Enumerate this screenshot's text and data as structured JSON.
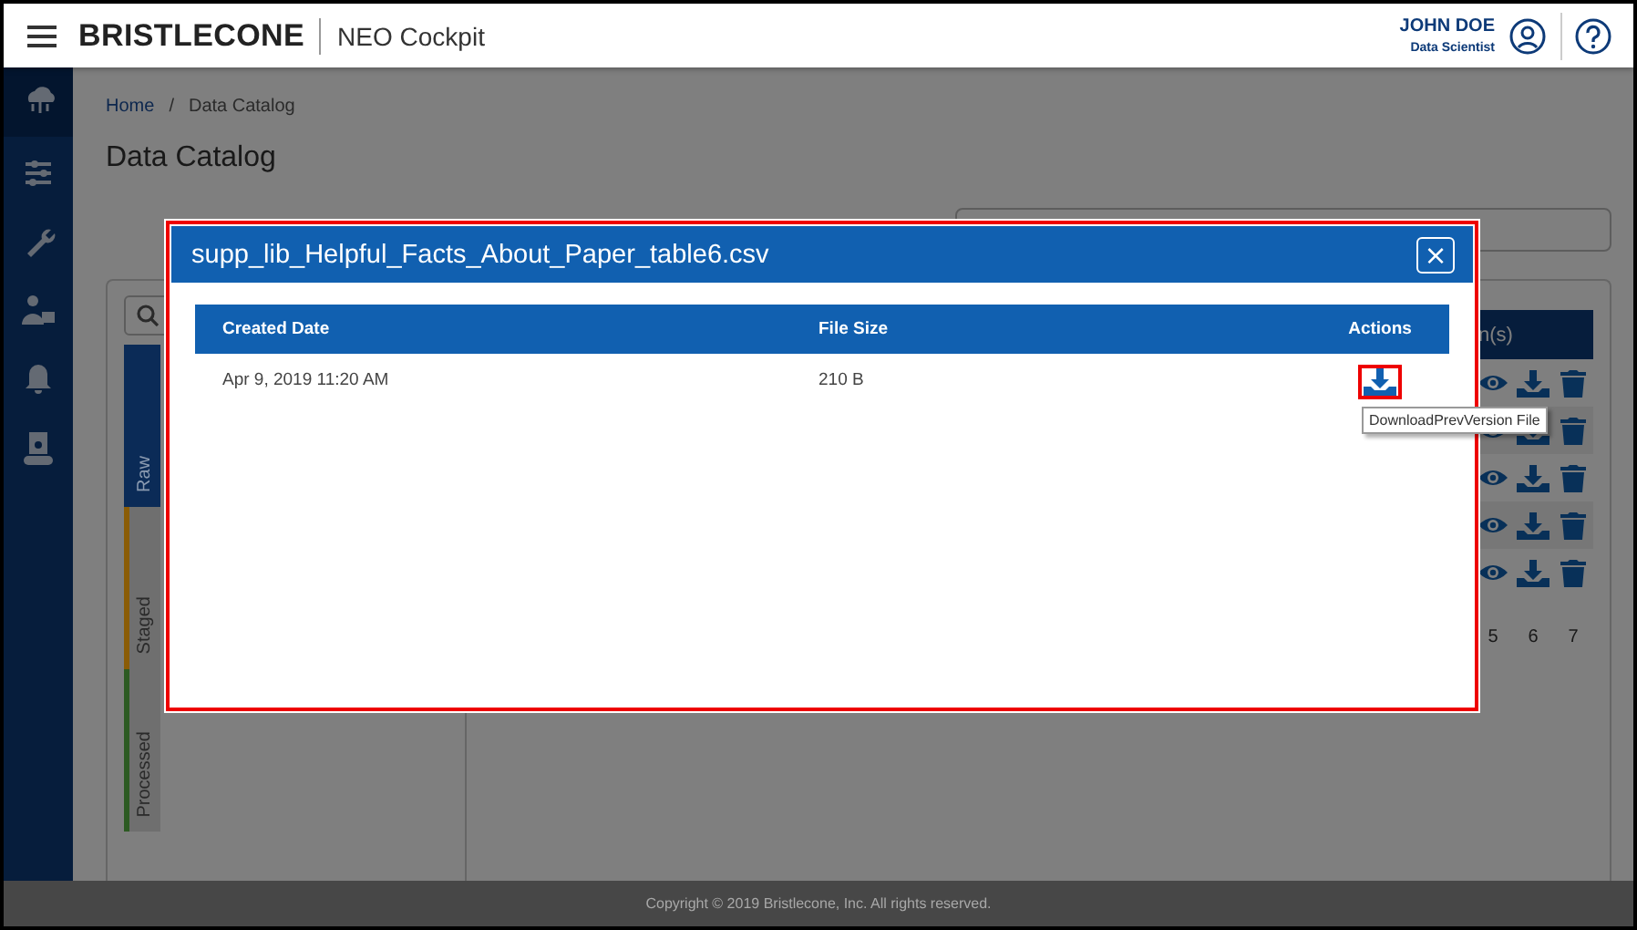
{
  "header": {
    "logo": "BRISTLECONE",
    "app_name": "NEO Cockpit",
    "user_name": "JOHN DOE",
    "user_role": "Data Scientist"
  },
  "sidebar": {
    "items": [
      {
        "kind": "cloud",
        "selected": true
      },
      {
        "kind": "flow",
        "selected": false
      },
      {
        "kind": "tools",
        "selected": false
      },
      {
        "kind": "users",
        "selected": false
      },
      {
        "kind": "bell",
        "selected": false
      },
      {
        "kind": "pipeline",
        "selected": false
      }
    ]
  },
  "breadcrumb": {
    "items": [
      "Home",
      "Data Catalog"
    ],
    "separator": "/"
  },
  "page_title": "Data Catalog",
  "zones": [
    {
      "label": "Raw",
      "selected": true,
      "color": "#0b2b57"
    },
    {
      "label": "Staged",
      "selected": false,
      "color": "#8a5c06"
    },
    {
      "label": "Processed",
      "selected": false,
      "color": "#2c5a22"
    }
  ],
  "files_table": {
    "column_header": "n(s)",
    "rows": [
      {
        "actions": [
          {
            "kind": "view"
          },
          {
            "kind": "download"
          },
          {
            "kind": "delete"
          }
        ]
      },
      {
        "actions": [
          {
            "kind": "view"
          },
          {
            "kind": "download"
          },
          {
            "kind": "delete"
          }
        ]
      },
      {
        "actions": [
          {
            "kind": "view"
          },
          {
            "kind": "download"
          },
          {
            "kind": "delete"
          }
        ]
      },
      {
        "actions": [
          {
            "kind": "view"
          },
          {
            "kind": "download"
          },
          {
            "kind": "delete"
          }
        ]
      },
      {
        "actions": [
          {
            "kind": "view"
          },
          {
            "kind": "download"
          },
          {
            "kind": "delete"
          }
        ]
      }
    ],
    "pagination": [
      "5",
      "6",
      "7"
    ]
  },
  "modal": {
    "title": "supp_lib_Helpful_Facts_About_Paper_table6.csv",
    "close": "×",
    "columns": [
      "Created Date",
      "File Size",
      "Actions"
    ],
    "rows": [
      {
        "created": "Apr 9, 2019 11:20 AM",
        "size": "210 B",
        "actions": [
          {
            "kind": "download",
            "highlighted": true
          }
        ]
      }
    ],
    "tooltip": "DownloadPrevVersion File"
  },
  "footer": "Copyright © 2019 Bristlecone, Inc. All rights reserved."
}
